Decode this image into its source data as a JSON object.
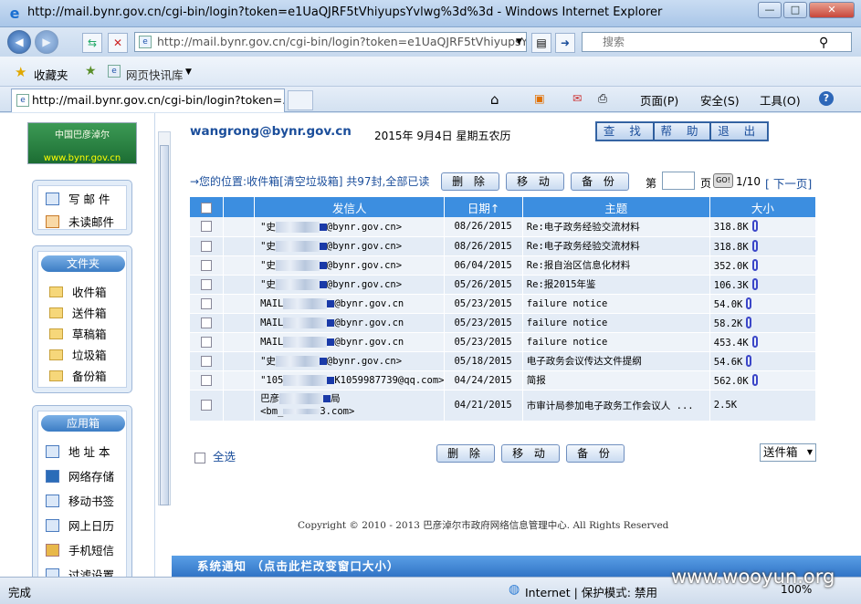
{
  "window": {
    "title": "http://mail.bynr.gov.cn/cgi-bin/login?token=e1UaQJRF5tVhiyupsYvlwg%3d%3d - Windows Internet Explorer"
  },
  "browser": {
    "url": "http://mail.bynr.gov.cn/cgi-bin/login?token=e1UaQJRF5tVhiyupsYv",
    "search_placeholder": "搜索",
    "favorites_label": "收藏夹",
    "quick_sites_label": "网页快讯库",
    "tab_title": "http://mail.bynr.gov.cn/cgi-bin/login?token=...",
    "commands": {
      "page": "页面(P)",
      "safety": "安全(S)",
      "tools": "工具(O)"
    }
  },
  "sidebar": {
    "logo": {
      "line1": "中国巴彦淖尔",
      "line2": "www.bynr.gov.cn"
    },
    "quick": [
      {
        "label": "写 邮 件"
      },
      {
        "label": "未读邮件"
      }
    ],
    "folders_title": "文件夹",
    "folders": [
      {
        "label": "收件箱"
      },
      {
        "label": "送件箱"
      },
      {
        "label": "草稿箱"
      },
      {
        "label": "垃圾箱"
      },
      {
        "label": "备份箱"
      }
    ],
    "apps_title": "应用箱",
    "apps": [
      {
        "label": "地 址 本"
      },
      {
        "label": "网络存储"
      },
      {
        "label": "移动书签"
      },
      {
        "label": "网上日历"
      },
      {
        "label": "手机短信"
      },
      {
        "label": "过滤设置"
      }
    ]
  },
  "header": {
    "email": "wangrong@bynr.gov.cn",
    "date": "2015年 9月4日 星期五农历",
    "buttons": [
      "查 找",
      "帮 助",
      "退 出"
    ]
  },
  "toolbar": {
    "location": "→您的位置:收件箱[清空垃圾箱] 共97封,全部已读",
    "delete": "删 除",
    "move": "移 动",
    "backup": "备 份",
    "page_prefix": "第",
    "page_suffix": "页",
    "go": "GO!",
    "page_count": "1/10",
    "next": "[ 下一页]"
  },
  "table": {
    "headers": {
      "sender": "发信人",
      "date": "日期↑",
      "subject": "主题",
      "size": "大小"
    },
    "rows": [
      {
        "s1": "\"史",
        "s2": "@bynr.gov.cn>",
        "date": "08/26/2015",
        "subject": "Re:电子政务经验交流材料",
        "size": "318.8K"
      },
      {
        "s1": "\"史",
        "s2": "@bynr.gov.cn>",
        "date": "08/26/2015",
        "subject": "Re:电子政务经验交流材料",
        "size": "318.8K"
      },
      {
        "s1": "\"史",
        "s2": "@bynr.gov.cn>",
        "date": "06/04/2015",
        "subject": "Re:报自治区信息化材料",
        "size": "352.0K"
      },
      {
        "s1": "\"史",
        "s2": "@bynr.gov.cn>",
        "date": "05/26/2015",
        "subject": "Re:报2015年鉴",
        "size": "106.3K"
      },
      {
        "s1": "MAIL",
        "s2": "@bynr.gov.cn",
        "date": "05/23/2015",
        "subject": "failure notice",
        "size": "54.0K"
      },
      {
        "s1": "MAIL",
        "s2": "@bynr.gov.cn",
        "date": "05/23/2015",
        "subject": "failure notice",
        "size": "58.2K"
      },
      {
        "s1": "MAIL",
        "s2": "@bynr.gov.cn",
        "date": "05/23/2015",
        "subject": "failure notice",
        "size": "453.4K"
      },
      {
        "s1": "\"史",
        "s2": "@bynr.gov.cn>",
        "date": "05/18/2015",
        "subject": "电子政务会议传达文件提纲",
        "size": "54.6K"
      },
      {
        "s1": "\"105",
        "s2": "K1059987739@qq.com>",
        "date": "04/24/2015",
        "subject": "简报",
        "size": "562.0K"
      },
      {
        "s1": "巴彦",
        "s2": "局",
        "s3": "<bm_",
        "s4": "3.com>",
        "date": "04/21/2015",
        "subject": "市审计局参加电子政务工作会议人 ...",
        "size": "2.5K"
      }
    ]
  },
  "bottom": {
    "select_all": "全选",
    "delete": "删 除",
    "move": "移 动",
    "backup": "备 份",
    "folder_selected": "送件箱",
    "copyright": "Copyright © 2010 - 2013 巴彦淖尔市政府网络信息管理中心. All Rights Reserved",
    "notice": "系统通知 （点击此栏改变窗口大小）"
  },
  "status": {
    "left": "完成",
    "zone": "Internet | 保护模式: 禁用",
    "zoom": "100%"
  },
  "watermark": "www.wooyun.org"
}
